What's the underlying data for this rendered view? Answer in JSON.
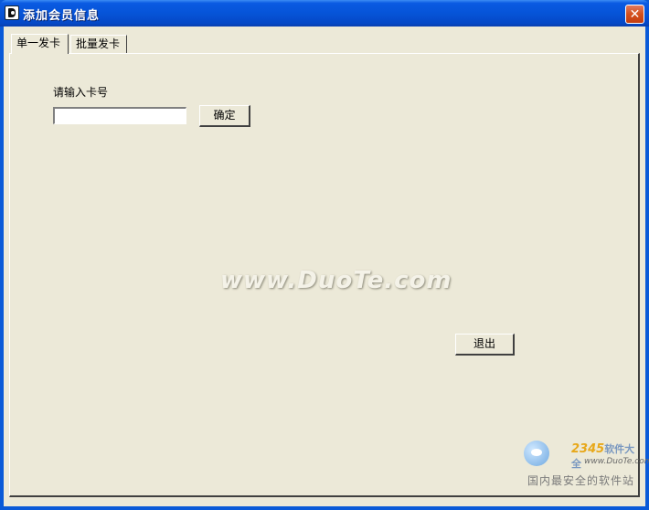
{
  "window": {
    "title": "添加会员信息",
    "close_icon": "close-icon",
    "app_icon": "app-icon"
  },
  "tabs": [
    {
      "label": "单一发卡",
      "active": true
    },
    {
      "label": "批量发卡",
      "active": false
    }
  ],
  "form": {
    "card_label": "请输入卡号",
    "card_input_value": "",
    "confirm_label": "确定",
    "exit_label": "退出"
  },
  "watermark": {
    "text": "www.DuoTe.com"
  },
  "brand": {
    "logo": "2345",
    "logo_suffix": "软件大全",
    "url": "www.DuoTe.com",
    "slogan": "国内最安全的软件站"
  },
  "colors": {
    "titlebar": "#0a5ad8",
    "client_bg": "#ece9d8",
    "close_button": "#d4501c"
  }
}
